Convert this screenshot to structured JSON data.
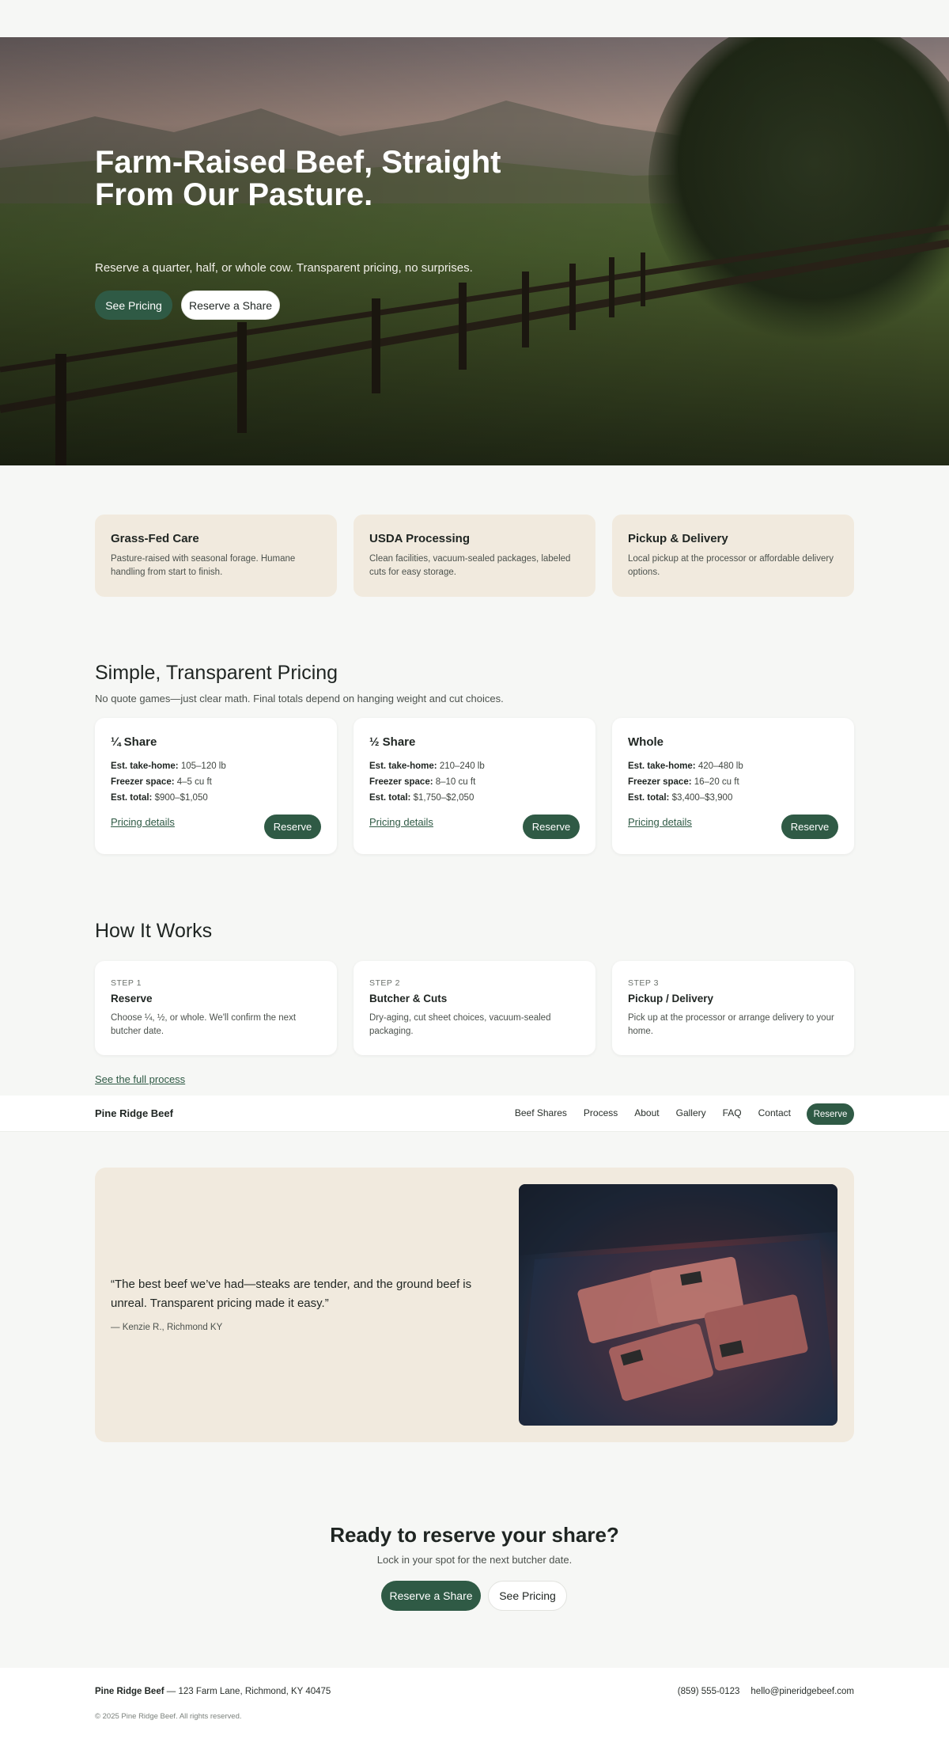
{
  "hero": {
    "title": "Farm-Raised Beef, Straight From Our Pasture.",
    "subtitle": "Reserve a quarter, half, or whole cow. Transparent pricing, no surprises.",
    "btn_pricing": "See Pricing",
    "btn_reserve": "Reserve a Share"
  },
  "features": [
    {
      "title": "Grass-Fed Care",
      "text": "Pasture-raised with seasonal forage. Humane handling from start to finish."
    },
    {
      "title": "USDA Processing",
      "text": "Clean facilities, vacuum-sealed packages, labeled cuts for easy storage."
    },
    {
      "title": "Pickup & Delivery",
      "text": "Local pickup at the processor or affordable delivery options."
    }
  ],
  "pricing": {
    "title": "Simple, Transparent Pricing",
    "subtitle": "No quote games—just clear math. Final totals depend on hanging weight and cut choices.",
    "labels": {
      "take_home": "Est. take-home:",
      "freezer": "Freezer space:",
      "total": "Est. total:"
    },
    "link": "Pricing details",
    "reserve": "Reserve",
    "plans": [
      {
        "name": "¼ Share",
        "take_home": "105–120 lb",
        "freezer": "4–5 cu ft",
        "total": "$900–$1,050"
      },
      {
        "name": "½ Share",
        "take_home": "210–240 lb",
        "freezer": "8–10 cu ft",
        "total": "$1,750–$2,050"
      },
      {
        "name": "Whole",
        "take_home": "420–480 lb",
        "freezer": "16–20 cu ft",
        "total": "$3,400–$3,900"
      }
    ]
  },
  "how": {
    "title": "How It Works",
    "steps": [
      {
        "step": "STEP 1",
        "title": "Reserve",
        "text": "Choose ¼, ½, or whole. We'll confirm the next butcher date."
      },
      {
        "step": "STEP 2",
        "title": "Butcher & Cuts",
        "text": "Dry-aging, cut sheet choices, vacuum-sealed packaging."
      },
      {
        "step": "STEP 3",
        "title": "Pickup / Delivery",
        "text": "Pick up at the processor or arrange delivery to your home."
      }
    ],
    "full_link": "See the full process"
  },
  "nav": {
    "brand": "Pine Ridge Beef",
    "items": [
      "Beef Shares",
      "Process",
      "About",
      "Gallery",
      "FAQ",
      "Contact"
    ],
    "reserve": "Reserve"
  },
  "testimonial": {
    "quote": "“The best beef we’ve had—steaks are tender, and the ground beef is unreal. Transparent pricing made it easy.”",
    "author": "— Kenzie R., Richmond KY"
  },
  "cta": {
    "title": "Ready to reserve your share?",
    "subtitle": "Lock in your spot for the next butcher date.",
    "btn_reserve": "Reserve a Share",
    "btn_pricing": "See Pricing"
  },
  "footer": {
    "brand": "Pine Ridge Beef",
    "address": " — 123 Farm Lane, Richmond, KY 40475",
    "phone": "(859) 555-0123",
    "email": "hello@pineridgebeef.com",
    "copyright": "© 2025 Pine Ridge Beef. All rights reserved."
  },
  "colors": {
    "accent": "#2f5a45",
    "sand": "#f1eade",
    "background": "#f6f7f5"
  }
}
